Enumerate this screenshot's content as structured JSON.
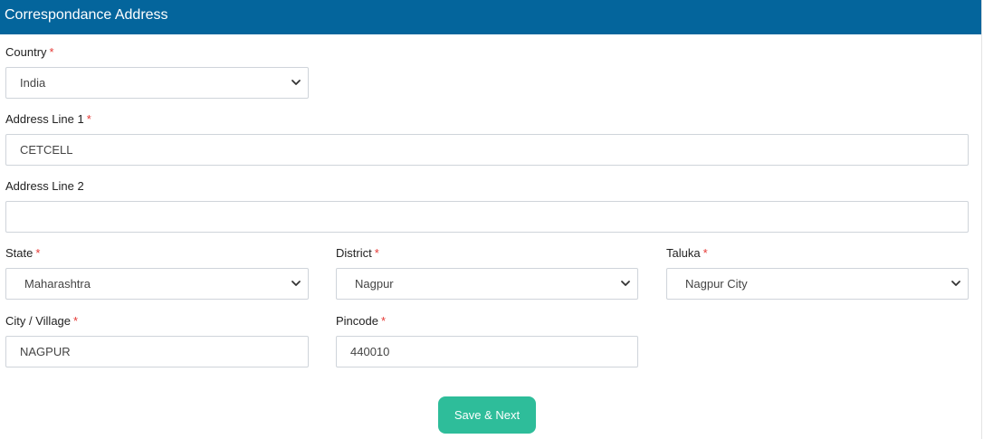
{
  "header": {
    "title": "Correspondance Address"
  },
  "required_mark": "*",
  "fields": {
    "country": {
      "label": "Country",
      "value": "India"
    },
    "address1": {
      "label": "Address Line 1",
      "value": "CETCELL"
    },
    "address2": {
      "label": "Address Line 2",
      "value": ""
    },
    "state": {
      "label": "State",
      "value": "Maharashtra"
    },
    "district": {
      "label": "District",
      "value": "Nagpur"
    },
    "taluka": {
      "label": "Taluka",
      "value": "Nagpur City"
    },
    "city": {
      "label": "City / Village",
      "value": "NAGPUR"
    },
    "pincode": {
      "label": "Pincode",
      "value": "440010"
    }
  },
  "actions": {
    "save_next": "Save & Next"
  },
  "colors": {
    "header_bg": "#04659c",
    "button_bg": "#2ebd9a",
    "required": "#e53935"
  }
}
